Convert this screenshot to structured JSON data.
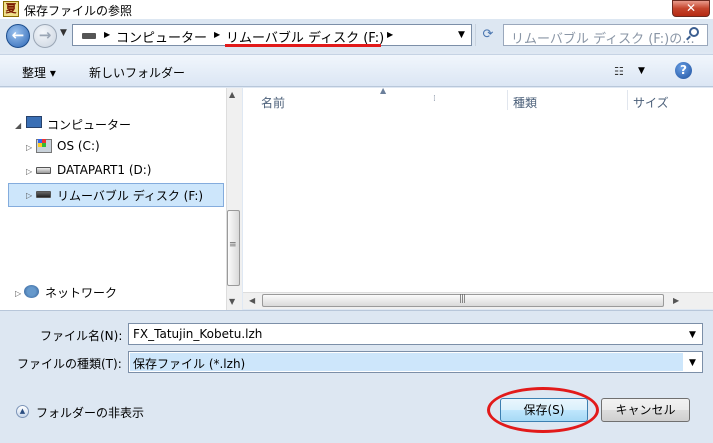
{
  "window": {
    "title": "保存ファイルの参照",
    "close_label": "✕",
    "app_icon_glyph": "夏"
  },
  "nav": {
    "back_icon": "←",
    "forward_icon": "→",
    "address": [
      "コンピューター",
      "リムーバブル ディスク (F:)"
    ],
    "refresh_icon": "⟳",
    "search_placeholder": "リムーバブル ディスク (F:)の..."
  },
  "toolbar": {
    "organize_label": "整理 ▾",
    "new_folder_label": "新しいフォルダー",
    "views_icon": "☷",
    "help_label": "?"
  },
  "tree": {
    "computer": "コンピューター",
    "os": "OS (C:)",
    "datapart": "DATAPART1 (D:)",
    "removable": "リムーバブル ディスク (F:)",
    "network": "ネットワーク"
  },
  "columns": {
    "name": "名前",
    "type": "種類",
    "size": "サイズ"
  },
  "form": {
    "filename_label": "ファイル名(N):",
    "filename_value": "FX_Tatujin_Kobetu.lzh",
    "filetype_label": "ファイルの種類(T):",
    "filetype_value": "保存ファイル (*.lzh)"
  },
  "footer": {
    "hide_folders_label": "フォルダーの非表示",
    "save_label": "保存(S)",
    "cancel_label": "キャンセル"
  },
  "colors": {
    "accent_red": "#e21a1a",
    "selection": "#cde6fb"
  }
}
